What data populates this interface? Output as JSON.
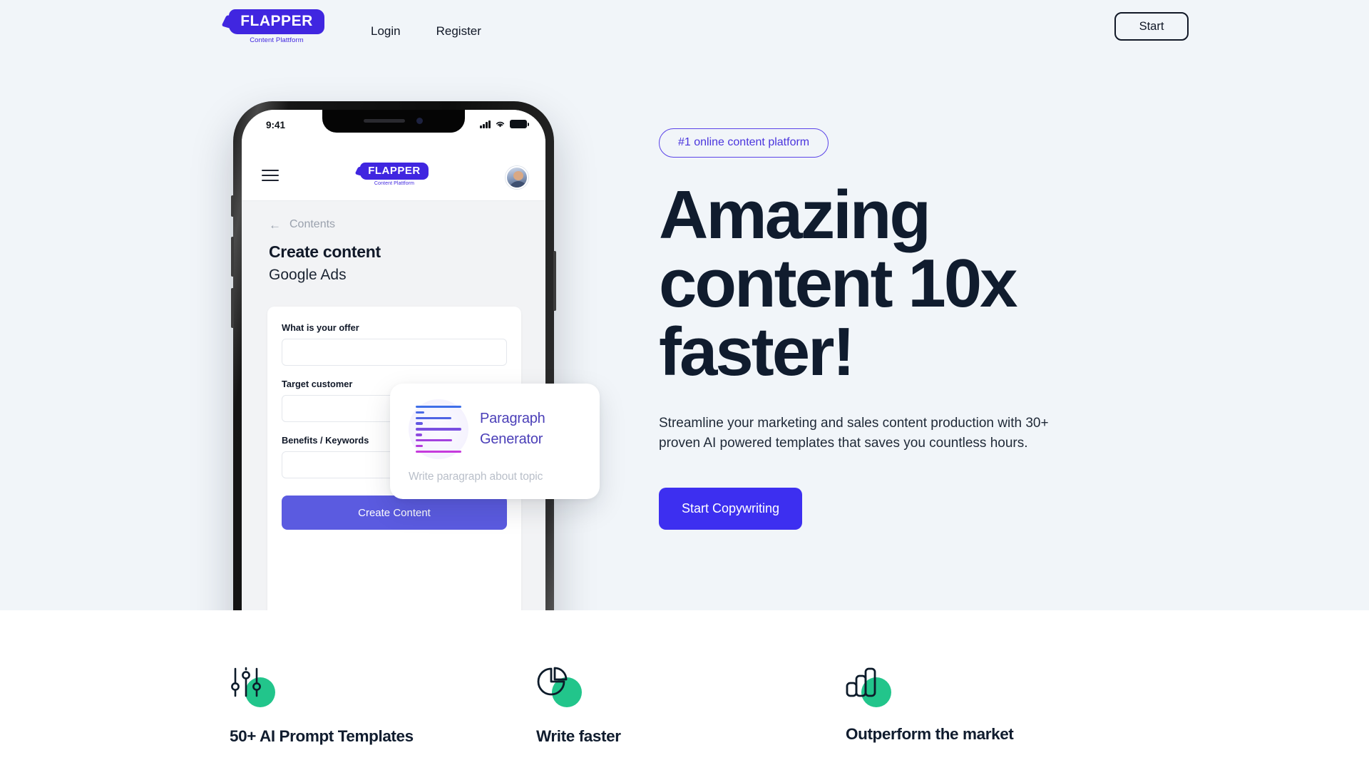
{
  "nav": {
    "brand_name": "FLAPPER",
    "brand_sub": "Content Plattform",
    "links": [
      {
        "label": "Login"
      },
      {
        "label": "Register"
      }
    ],
    "start_label": "Start"
  },
  "phone": {
    "status": {
      "time": "9:41"
    },
    "app_brand_name": "FLAPPER",
    "app_brand_sub": "Content Plattform",
    "back_arrow": "←",
    "back_label": "Contents",
    "heading": "Create content",
    "subheading": "Google Ads",
    "fields": [
      {
        "label": "What is your offer",
        "value": ""
      },
      {
        "label": "Target customer",
        "value": ""
      },
      {
        "label": "Benefits / Keywords",
        "value": ""
      }
    ],
    "submit_label": "Create Content"
  },
  "float_card": {
    "title": "Paragraph Generator",
    "description": "Write paragraph about topic"
  },
  "hero": {
    "badge": "#1 online content platform",
    "title": "Amazing content 10x faster!",
    "paragraph": "Streamline your marketing and sales content production with 30+ proven AI powered templates that saves you countless hours.",
    "cta_label": "Start Copywriting"
  },
  "features": [
    {
      "icon": "sliders-icon",
      "title": "50+ AI Prompt Templates"
    },
    {
      "icon": "pie-chart-icon",
      "title": "Write faster"
    },
    {
      "icon": "bar-chart-icon",
      "title": "Outperform the market"
    }
  ],
  "colors": {
    "hero_bg": "#f1f5f9",
    "brand_purple": "#4026e0",
    "cta_blue": "#3d2ff0",
    "accent_green": "#22c58b",
    "title_navy": "#101c2e"
  }
}
